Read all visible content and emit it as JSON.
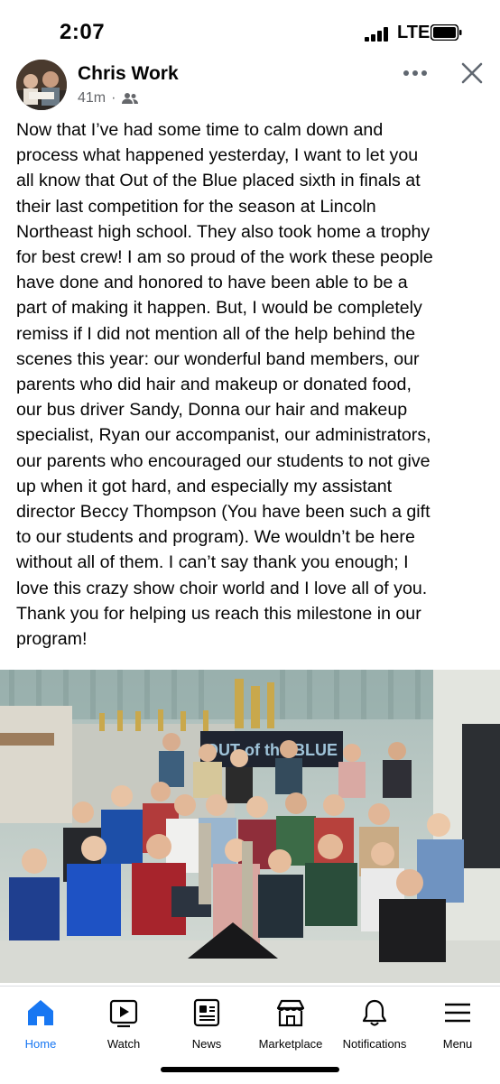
{
  "status_bar": {
    "time": "2:07",
    "network": "LTE"
  },
  "post": {
    "author": "Chris Work",
    "timestamp": "41m",
    "audience_icon": "friends-icon",
    "body": "Now that I’ve had some time to calm down and\nprocess what happened yesterday, I want to let you\nall know that Out of the Blue placed sixth in finals at\ntheir last competition for the season at Lincoln\nNortheast high school. They also took home a trophy\nfor best crew! I am so proud of the work these people\nhave done and honored to have been able to be a\npart of making it happen. But, I would be completely\nremiss if I did not mention all of the help behind the\nscenes this year: our wonderful band members, our\nparents who did hair and makeup or donated food,\nour bus driver Sandy, Donna our hair and makeup\nspecialist, Ryan our accompanist, our administrators,\nour parents who encouraged our students to not give\nup when it got hard, and especially my assistant\ndirector Beccy Thompson (You have been such a gift\nto our students and program). We wouldn’t be here\nwithout all of them. I can’t say thank you enough; I\nlove this crazy show choir world and I love all of you.\nThank you for helping us reach this milestone in our\nprogram!",
    "photo_banner": "OUT of the BLUE"
  },
  "tabs": [
    {
      "label": "Home",
      "icon": "home-icon",
      "active": true
    },
    {
      "label": "Watch",
      "icon": "watch-icon",
      "active": false
    },
    {
      "label": "News",
      "icon": "news-icon",
      "active": false
    },
    {
      "label": "Marketplace",
      "icon": "marketplace-icon",
      "active": false
    },
    {
      "label": "Notifications",
      "icon": "bell-icon",
      "active": false
    },
    {
      "label": "Menu",
      "icon": "menu-icon",
      "active": false
    }
  ],
  "colors": {
    "accent": "#1877f2",
    "muted": "#65676b"
  }
}
